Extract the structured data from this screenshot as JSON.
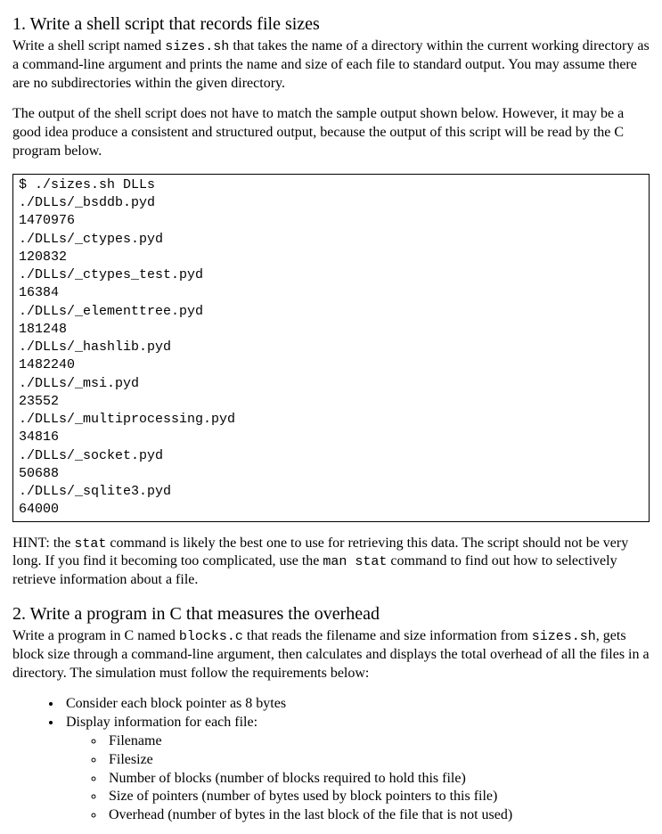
{
  "section1": {
    "heading": "1. Write a shell script that records file sizes",
    "intro_a": "Write a shell script named ",
    "intro_code1": "sizes.sh",
    "intro_b": " that takes the name of a directory within the current working directory as a command-line argument and prints the name and size of each file to standard output. You may assume there are no subdirectories within the given directory.",
    "para2": "The output of the shell script does not have to match the sample output shown below. However, it may be a good idea produce a consistent and structured output, because the output of this script will be read by the C program below.",
    "code_block": "$ ./sizes.sh DLLs\n./DLLs/_bsddb.pyd\n1470976\n./DLLs/_ctypes.pyd\n120832\n./DLLs/_ctypes_test.pyd\n16384\n./DLLs/_elementtree.pyd\n181248\n./DLLs/_hashlib.pyd\n1482240\n./DLLs/_msi.pyd\n23552\n./DLLs/_multiprocessing.pyd\n34816\n./DLLs/_socket.pyd\n50688\n./DLLs/_sqlite3.pyd\n64000",
    "hint_a": "HINT: the ",
    "hint_code1": "stat",
    "hint_b": " command is likely the best one to use for retrieving this data. The script should not be very long. If you find it becoming too complicated, use the ",
    "hint_code2": "man stat",
    "hint_c": " command to find out how to selectively retrieve information about a file."
  },
  "section2": {
    "heading": "2. Write a program in C that measures the overhead",
    "intro_a": "Write a program in C named ",
    "intro_code1": "blocks.c",
    "intro_b": " that reads the filename and size information from ",
    "intro_code2": "sizes.sh",
    "intro_c": ", gets block size through a command-line argument, then calculates and displays the total overhead of all the files in a directory. The simulation must follow the requirements below:",
    "bullets": {
      "b1": "Consider each block pointer as 8 bytes",
      "b2": "Display information for each file:",
      "sub": {
        "s1": "Filename",
        "s2": "Filesize",
        "s3": "Number of blocks (number of blocks required to hold this file)",
        "s4": "Size of pointers (number of bytes used by block pointers to this file)",
        "s5": "Overhead (number of bytes in the last block of the file that is not used)"
      }
    }
  }
}
